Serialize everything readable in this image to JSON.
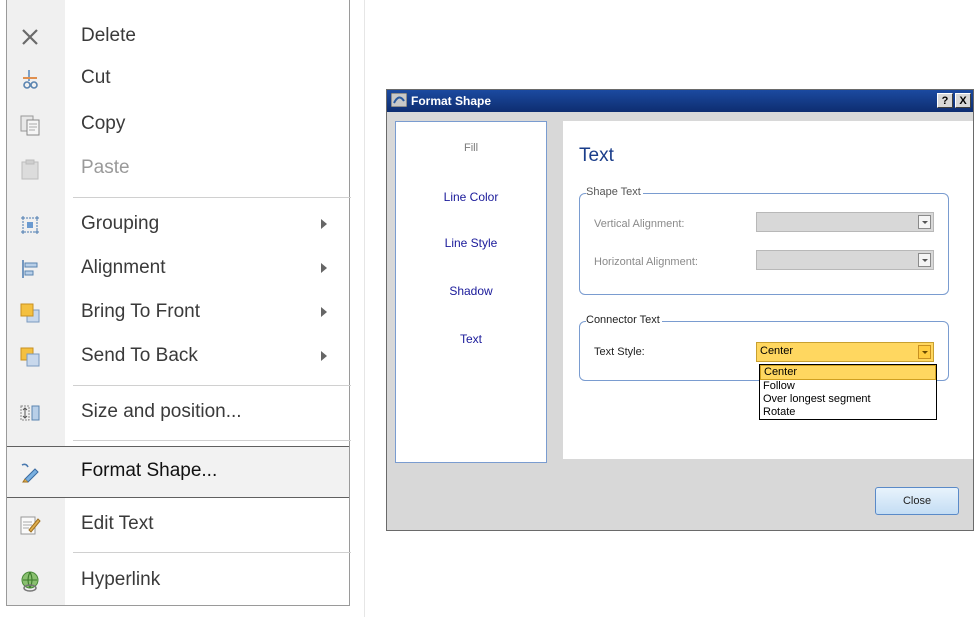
{
  "context_menu": {
    "items": [
      {
        "label": "Delete",
        "icon": "delete-icon"
      },
      {
        "label": "Cut",
        "icon": "cut-icon"
      },
      {
        "label": "Copy",
        "icon": "copy-icon"
      },
      {
        "label": "Paste",
        "icon": "paste-icon"
      },
      {
        "label": "Grouping",
        "icon": "grouping-icon"
      },
      {
        "label": "Alignment",
        "icon": "alignment-icon"
      },
      {
        "label": "Bring To Front",
        "icon": "bring-to-front-icon"
      },
      {
        "label": "Send To Back",
        "icon": "send-to-back-icon"
      },
      {
        "label": "Size and position...",
        "icon": "size-position-icon"
      },
      {
        "label": "Format Shape...",
        "icon": "format-shape-icon"
      },
      {
        "label": "Edit Text",
        "icon": "edit-text-icon"
      },
      {
        "label": "Hyperlink",
        "icon": "hyperlink-icon"
      }
    ],
    "disabled": [
      "Paste"
    ],
    "selected": "Format Shape..."
  },
  "dialog": {
    "title": "Format Shape",
    "help_button": "?",
    "close_x": "X",
    "nav": [
      "Fill",
      "Line Color",
      "Line Style",
      "Shadow",
      "Text"
    ],
    "content": {
      "heading": "Text",
      "shape_text_group": {
        "title": "Shape Text",
        "vertical_alignment_label": "Vertical Alignment:",
        "horizontal_alignment_label": "Horizontal Alignment:"
      },
      "connector_text_group": {
        "title": "Connector Text",
        "text_style_label": "Text Style:",
        "text_style_value": "Center",
        "options": [
          "Center",
          "Follow",
          "Over longest segment",
          "Rotate"
        ]
      }
    },
    "close_button": "Close"
  },
  "colors": {
    "titlebar": "#1b4aa0",
    "accent_blue": "#1a3d8a",
    "highlight": "#ffd760"
  }
}
